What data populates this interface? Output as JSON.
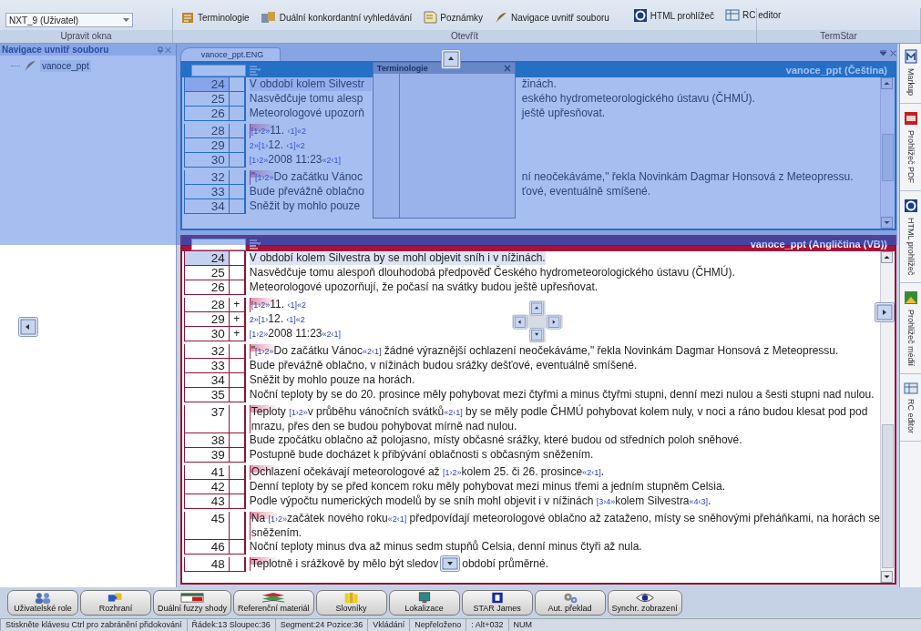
{
  "ribbon": {
    "groups": [
      {
        "label": "Upravit okna",
        "dropdown": {
          "value": "NXT_9 (Uživatel)"
        }
      },
      {
        "label": "Otevřít",
        "buttons": [
          {
            "label": "Terminologie"
          },
          {
            "label": "Duální konkordantní vyhledávání"
          },
          {
            "label": "Poznámky"
          },
          {
            "label": "Navigace uvnitř souboru"
          },
          {
            "label": "HTML prohlížeč"
          },
          {
            "label": "RC editor"
          }
        ]
      },
      {
        "label": "TermStar"
      }
    ]
  },
  "file_nav": {
    "title": "Navigace uvnitř souboru",
    "items": [
      {
        "label": "vanoce_ppt",
        "selected": true
      }
    ]
  },
  "document_tab": {
    "label": "vanoce_ppt.ENG",
    "selected": true
  },
  "source_pane": {
    "title": "vanoce_ppt (Čeština)",
    "rows": [
      {
        "number": "24",
        "selected": true,
        "start": false,
        "parts": [
          {
            "kind": "text",
            "text": "V období kolem Silvestr"
          },
          {
            "kind": "covered"
          },
          {
            "kind": "text",
            "text": "žinách."
          }
        ]
      },
      {
        "number": "25",
        "selected": false,
        "start": false,
        "parts": [
          {
            "kind": "text",
            "text": "Nasvědčuje tomu alesp"
          },
          {
            "kind": "covered"
          },
          {
            "kind": "text",
            "text": "eského hydrometeorologického ústavu (ČHMÚ)."
          }
        ]
      },
      {
        "number": "26",
        "selected": false,
        "start": false,
        "parts": [
          {
            "kind": "text",
            "text": "Meteorologové upozorň"
          },
          {
            "kind": "covered"
          },
          {
            "kind": "text",
            "text": "ještě upřesňovat."
          }
        ]
      },
      {
        "number": "28",
        "selected": false,
        "start": true,
        "parts": [
          {
            "kind": "tag",
            "text": "[1›2»"
          },
          {
            "kind": "text",
            "text": "11. "
          },
          {
            "kind": "tag",
            "text": "‹1]«2"
          }
        ]
      },
      {
        "number": "29",
        "selected": false,
        "start": false,
        "parts": [
          {
            "kind": "tag",
            "text": "2»[1›"
          },
          {
            "kind": "text",
            "text": "12. "
          },
          {
            "kind": "tag",
            "text": "‹1]«2"
          }
        ]
      },
      {
        "number": "30",
        "selected": false,
        "start": false,
        "parts": [
          {
            "kind": "tag",
            "text": "[1›2»"
          },
          {
            "kind": "text",
            "text": "2008 11:23"
          },
          {
            "kind": "tag",
            "text": "«2‹1]"
          }
        ]
      },
      {
        "number": "32",
        "selected": false,
        "start": true,
        "parts": [
          {
            "kind": "text",
            "text": "\""
          },
          {
            "kind": "tag",
            "text": "[1›2»"
          },
          {
            "kind": "text",
            "text": "Do začátku Vánoc"
          },
          {
            "kind": "covered"
          },
          {
            "kind": "text",
            "text": "ní neočekáváme,\" řekla Novinkám Dagmar Honsová z Meteopressu."
          }
        ]
      },
      {
        "number": "33",
        "selected": false,
        "start": false,
        "parts": [
          {
            "kind": "text",
            "text": "Bude převážně oblačno"
          },
          {
            "kind": "covered"
          },
          {
            "kind": "text",
            "text": "ťové, eventuálně smíšené."
          }
        ]
      },
      {
        "number": "34",
        "selected": false,
        "start": false,
        "parts": [
          {
            "kind": "text",
            "text": "Sněžit by mohlo pouze"
          },
          {
            "kind": "covered"
          }
        ]
      }
    ]
  },
  "terminology_window": {
    "title": "Terminologie"
  },
  "target_pane": {
    "title": "vanoce_ppt (Angličtina (VB))",
    "rows": [
      {
        "number": "24",
        "selected": true,
        "start": false,
        "parts": [
          {
            "kind": "text",
            "text": "V období kolem Silvestra by se mohl objevit sníh i v nížinách."
          }
        ]
      },
      {
        "number": "25",
        "selected": false,
        "start": false,
        "parts": [
          {
            "kind": "text",
            "text": "Nasvědčuje tomu alespoň dlouhodobá předpověď Českého hydrometeorologického ústavu (ČHMÚ)."
          }
        ]
      },
      {
        "number": "26",
        "selected": false,
        "start": false,
        "parts": [
          {
            "kind": "text",
            "text": "Meteorologové upozorňují, že počasí na svátky budou ještě upřesňovat."
          }
        ]
      },
      {
        "number": "28",
        "flag": "+",
        "selected": false,
        "start": true,
        "parts": [
          {
            "kind": "tag",
            "text": "[1›2»"
          },
          {
            "kind": "text",
            "text": "11. "
          },
          {
            "kind": "tag",
            "text": "‹1]«2"
          }
        ]
      },
      {
        "number": "29",
        "flag": "+",
        "selected": false,
        "start": false,
        "parts": [
          {
            "kind": "tag",
            "text": "2»[1›"
          },
          {
            "kind": "text",
            "text": "12. "
          },
          {
            "kind": "tag",
            "text": "‹1]«2"
          }
        ]
      },
      {
        "number": "30",
        "flag": "+",
        "selected": false,
        "start": false,
        "parts": [
          {
            "kind": "tag",
            "text": "[1›2»"
          },
          {
            "kind": "text",
            "text": "2008 11:23"
          },
          {
            "kind": "tag",
            "text": "«2‹1]"
          }
        ]
      },
      {
        "number": "32",
        "selected": false,
        "start": true,
        "parts": [
          {
            "kind": "text",
            "text": "\""
          },
          {
            "kind": "tag",
            "text": "[1›2»"
          },
          {
            "kind": "text",
            "text": "Do začátku Vánoc"
          },
          {
            "kind": "tag",
            "text": "«2‹1]"
          },
          {
            "kind": "text",
            "text": " žádné výraznější ochlazení neočekáváme,\" řekla Novinkám Dagmar Honsová z Meteopressu."
          }
        ]
      },
      {
        "number": "33",
        "selected": false,
        "start": false,
        "parts": [
          {
            "kind": "text",
            "text": "Bude převážně oblačno, v nížinách budou srážky dešťové, eventuálně smíšené."
          }
        ]
      },
      {
        "number": "34",
        "selected": false,
        "start": false,
        "parts": [
          {
            "kind": "text",
            "text": "Sněžit by mohlo pouze na horách."
          }
        ]
      },
      {
        "number": "35",
        "selected": false,
        "start": false,
        "parts": [
          {
            "kind": "text",
            "text": "Noční teploty by se do 20. prosince měly pohybovat mezi čtyřmi a minus čtyřmi stupni, denní mezi nulou a šesti stupni nad nulou."
          }
        ]
      },
      {
        "number": "37",
        "selected": false,
        "start": true,
        "parts": [
          {
            "kind": "text",
            "text": "Teploty "
          },
          {
            "kind": "tag",
            "text": "[1›2»"
          },
          {
            "kind": "text",
            "text": "v průběhu vánočních svátků"
          },
          {
            "kind": "tag",
            "text": "«2‹1]"
          },
          {
            "kind": "text",
            "text": " by se měly podle ČHMÚ pohybovat kolem nuly, v noci a ráno budou klesat pod pod mrazu, přes den se budou pohybovat mírně nad nulou."
          }
        ]
      },
      {
        "number": "38",
        "selected": false,
        "start": false,
        "parts": [
          {
            "kind": "text",
            "text": "Bude zpočátku oblačno až polojasno, místy občasné srážky, které budou od středních poloh sněhové."
          }
        ]
      },
      {
        "number": "39",
        "selected": false,
        "start": false,
        "parts": [
          {
            "kind": "text",
            "text": "Postupně bude docházet k přibývání oblačnosti s občasným sněžením."
          }
        ]
      },
      {
        "number": "41",
        "selected": false,
        "start": true,
        "parts": [
          {
            "kind": "text",
            "text": "Ochlazení očekávají meteorologové až "
          },
          {
            "kind": "tag",
            "text": "[1›2»"
          },
          {
            "kind": "text",
            "text": "kolem 25. či 26. prosince"
          },
          {
            "kind": "tag",
            "text": "«2‹1]"
          },
          {
            "kind": "text",
            "text": "."
          }
        ]
      },
      {
        "number": "42",
        "selected": false,
        "start": false,
        "parts": [
          {
            "kind": "text",
            "text": "Denní teploty by se před koncem roku měly pohybovat mezi minus třemi a jedním stupněm Celsia."
          }
        ]
      },
      {
        "number": "43",
        "selected": false,
        "start": false,
        "parts": [
          {
            "kind": "text",
            "text": "Podle výpočtu numerických modelů by se sníh mohl objevit i v nížinách "
          },
          {
            "kind": "tag",
            "text": "[3›4»"
          },
          {
            "kind": "text",
            "text": "kolem Silvestra"
          },
          {
            "kind": "tag",
            "text": "«4‹3]"
          },
          {
            "kind": "text",
            "text": "."
          }
        ]
      },
      {
        "number": "45",
        "selected": false,
        "start": true,
        "parts": [
          {
            "kind": "text",
            "text": "Na "
          },
          {
            "kind": "tag",
            "text": "[1›2»"
          },
          {
            "kind": "text",
            "text": "začátek nového roku"
          },
          {
            "kind": "tag",
            "text": "«2‹1]"
          },
          {
            "kind": "text",
            "text": " předpovídají meteorologové oblačno až zataženo, místy se sněhovými přeháňkami, na horách se sněžením."
          }
        ]
      },
      {
        "number": "46",
        "selected": false,
        "start": false,
        "parts": [
          {
            "kind": "text",
            "text": "Noční teploty minus dva až minus sedm stupňů Celsia, denní minus čtyři až nula."
          }
        ]
      },
      {
        "number": "48",
        "selected": false,
        "start": true,
        "parts": [
          {
            "kind": "text",
            "text": "Teplotně i srážkově by mělo být sledov"
          },
          {
            "kind": "guide"
          },
          {
            "kind": "text",
            "text": "období průměrné."
          }
        ]
      }
    ]
  },
  "side_tabs": [
    {
      "label": "Markup"
    },
    {
      "label": "Prohlížeč PDF"
    },
    {
      "label": "HTML prohlížeč"
    },
    {
      "label": "Prohlížeč médií"
    },
    {
      "label": "RC editor"
    }
  ],
  "bottom_buttons": [
    {
      "label": "Uživatelské role"
    },
    {
      "label": "Rozhraní"
    },
    {
      "label": "Duální fuzzy shody"
    },
    {
      "label": "Referenční materiál"
    },
    {
      "label": "Slovníky"
    },
    {
      "label": "Lokalizace"
    },
    {
      "label": "STAR James"
    },
    {
      "label": "Aut. překlad"
    },
    {
      "label": "Synchr. zobrazení"
    }
  ],
  "status_bar": [
    {
      "text": "Stiskněte klávesu Ctrl pro zabránění přidokování"
    },
    {
      "text": "Řádek:13 Sloupec:36"
    },
    {
      "text": "Segment:24 Pozice:36"
    },
    {
      "text": "Vkládání"
    },
    {
      "text": "Nepřeloženo"
    },
    {
      "text": ": Alt+032"
    },
    {
      "text": "NUM"
    }
  ]
}
